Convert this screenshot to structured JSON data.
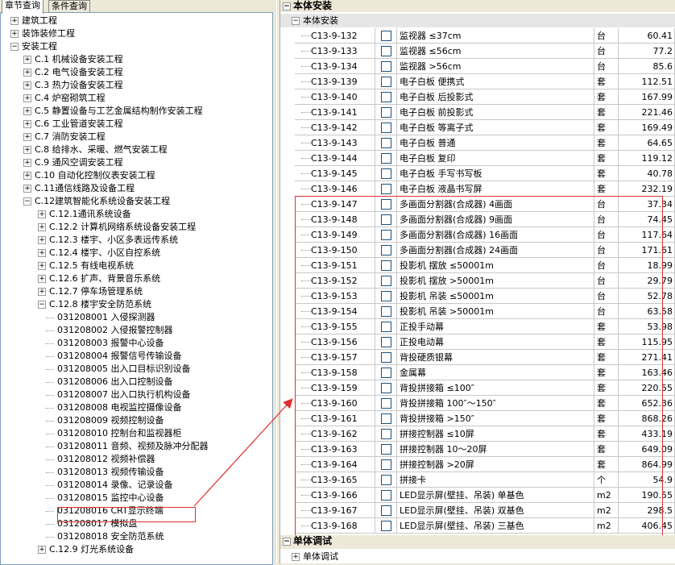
{
  "tabs": [
    "章节查询",
    "条件查询"
  ],
  "tree": [
    {
      "label": "建筑工程",
      "level": 0,
      "exp": "+"
    },
    {
      "label": "装饰装修工程",
      "level": 0,
      "exp": "+"
    },
    {
      "label": "安装工程",
      "level": 0,
      "exp": "-"
    },
    {
      "label": "C.1 机械设备安装工程",
      "level": 1,
      "exp": "+"
    },
    {
      "label": "C.2 电气设备安装工程",
      "level": 1,
      "exp": "+"
    },
    {
      "label": "C.3 热力设备安装工程",
      "level": 1,
      "exp": "+"
    },
    {
      "label": "C.4 炉窑砌筑工程",
      "level": 1,
      "exp": "+"
    },
    {
      "label": "C.5 静置设备与工艺金属结构制作安装工程",
      "level": 1,
      "exp": "+"
    },
    {
      "label": "C.6 工业管道安装工程",
      "level": 1,
      "exp": "+"
    },
    {
      "label": "C.7 消防安装工程",
      "level": 1,
      "exp": "+"
    },
    {
      "label": "C.8 给排水、采暖、燃气安装工程",
      "level": 1,
      "exp": "+"
    },
    {
      "label": "C.9 通风空调安装工程",
      "level": 1,
      "exp": "+"
    },
    {
      "label": "C.10 自动化控制仪表安装工程",
      "level": 1,
      "exp": "+"
    },
    {
      "label": "C.11通信线路及设备工程",
      "level": 1,
      "exp": "+"
    },
    {
      "label": "C.12建筑智能化系统设备安装工程",
      "level": 1,
      "exp": "-"
    },
    {
      "label": "C.12.1通讯系统设备",
      "level": 2,
      "exp": "+"
    },
    {
      "label": "C.12.2 计算机网络系统设备安装工程",
      "level": 2,
      "exp": "+"
    },
    {
      "label": "C.12.3 楼宇、小区多表远传系统",
      "level": 2,
      "exp": "+"
    },
    {
      "label": "C.12.4 楼宇、小区自控系统",
      "level": 2,
      "exp": "+"
    },
    {
      "label": "C.12.5 有线电视系统",
      "level": 2,
      "exp": "+"
    },
    {
      "label": "C.12.6 扩声、背景音乐系统",
      "level": 2,
      "exp": "+"
    },
    {
      "label": "C.12.7 停车场管理系统",
      "level": 2,
      "exp": "+"
    },
    {
      "label": "C.12.8 楼宇安全防范系统",
      "level": 2,
      "exp": "-"
    },
    {
      "label": "031208001   入侵探测器",
      "level": 3,
      "exp": ""
    },
    {
      "label": "031208002   入侵报警控制器",
      "level": 3,
      "exp": ""
    },
    {
      "label": "031208003   报警中心设备",
      "level": 3,
      "exp": ""
    },
    {
      "label": "031208004   报警信号传输设备",
      "level": 3,
      "exp": ""
    },
    {
      "label": "031208005   出入口目标识别设备",
      "level": 3,
      "exp": ""
    },
    {
      "label": "031208006   出入口控制设备",
      "level": 3,
      "exp": ""
    },
    {
      "label": "031208007   出入口执行机构设备",
      "level": 3,
      "exp": ""
    },
    {
      "label": "031208008   电视监控摄像设备",
      "level": 3,
      "exp": ""
    },
    {
      "label": "031208009   视频控制设备",
      "level": 3,
      "exp": ""
    },
    {
      "label": "031208010   控制台和监视器柜",
      "level": 3,
      "exp": ""
    },
    {
      "label": "031208011   音频、视频及脉冲分配器",
      "level": 3,
      "exp": ""
    },
    {
      "label": "031208012   视频补偿器",
      "level": 3,
      "exp": ""
    },
    {
      "label": "031208013   视频传输设备",
      "level": 3,
      "exp": ""
    },
    {
      "label": "031208014   录像、记录设备",
      "level": 3,
      "exp": ""
    },
    {
      "label": "031208015   监控中心设备",
      "level": 3,
      "exp": ""
    },
    {
      "label": "031208016   CRT显示终端",
      "level": 3,
      "exp": ""
    },
    {
      "label": "031208017   模拟盘",
      "level": 3,
      "exp": ""
    },
    {
      "label": "031208018   安全防范系统",
      "level": 3,
      "exp": ""
    },
    {
      "label": "C.12.9 灯光系统设备",
      "level": 2,
      "exp": "+"
    }
  ],
  "right_header": "本体安装",
  "right_subheader": "本体安装",
  "rows": [
    {
      "code": "C13-9-132",
      "name": "监视器 ≤37cm",
      "unit": "台",
      "qty": "60.41"
    },
    {
      "code": "C13-9-133",
      "name": "监视器 ≤56cm",
      "unit": "台",
      "qty": "77.2"
    },
    {
      "code": "C13-9-134",
      "name": "监视器 >56cm",
      "unit": "台",
      "qty": "85.6"
    },
    {
      "code": "C13-9-139",
      "name": "电子白板 便携式",
      "unit": "套",
      "qty": "112.51"
    },
    {
      "code": "C13-9-140",
      "name": "电子白板 后投影式",
      "unit": "套",
      "qty": "167.99"
    },
    {
      "code": "C13-9-141",
      "name": "电子白板 前投影式",
      "unit": "套",
      "qty": "221.46"
    },
    {
      "code": "C13-9-142",
      "name": "电子白板 等离子式",
      "unit": "套",
      "qty": "169.49"
    },
    {
      "code": "C13-9-143",
      "name": "电子白板 普通",
      "unit": "套",
      "qty": "64.65"
    },
    {
      "code": "C13-9-144",
      "name": "电子白板 复印",
      "unit": "套",
      "qty": "119.12"
    },
    {
      "code": "C13-9-145",
      "name": "电子白板 手写书写板",
      "unit": "套",
      "qty": "40.78"
    },
    {
      "code": "C13-9-146",
      "name": "电子白板 液晶书写屏",
      "unit": "套",
      "qty": "232.19"
    },
    {
      "code": "C13-9-147",
      "name": "多画面分割器(合成器) 4画面",
      "unit": "台",
      "qty": "37.34"
    },
    {
      "code": "C13-9-148",
      "name": "多画面分割器(合成器) 9画面",
      "unit": "台",
      "qty": "74.45"
    },
    {
      "code": "C13-9-149",
      "name": "多画面分割器(合成器) 16画面",
      "unit": "台",
      "qty": "117.64"
    },
    {
      "code": "C13-9-150",
      "name": "多画面分割器(合成器) 24画面",
      "unit": "台",
      "qty": "171.61"
    },
    {
      "code": "C13-9-151",
      "name": "投影机 摆放 ≤50001m",
      "unit": "台",
      "qty": "18.99"
    },
    {
      "code": "C13-9-152",
      "name": "投影机 摆放 >50001m",
      "unit": "台",
      "qty": "29.79"
    },
    {
      "code": "C13-9-153",
      "name": "投影机 吊装 ≤50001m",
      "unit": "台",
      "qty": "52.78"
    },
    {
      "code": "C13-9-154",
      "name": "投影机 吊装 >50001m",
      "unit": "台",
      "qty": "63.58"
    },
    {
      "code": "C13-9-155",
      "name": "正投手动幕",
      "unit": "套",
      "qty": "53.98"
    },
    {
      "code": "C13-9-156",
      "name": "正投电动幕",
      "unit": "套",
      "qty": "115.95"
    },
    {
      "code": "C13-9-157",
      "name": "背投硬质银幕",
      "unit": "套",
      "qty": "271.41"
    },
    {
      "code": "C13-9-158",
      "name": "金属幕",
      "unit": "套",
      "qty": "163.46"
    },
    {
      "code": "C13-9-159",
      "name": "背投拼接箱 ≤100″",
      "unit": "套",
      "qty": "220.55"
    },
    {
      "code": "C13-9-160",
      "name": "背投拼接箱 100″～150″",
      "unit": "套",
      "qty": "652.36"
    },
    {
      "code": "C13-9-161",
      "name": "背投拼接箱 >150″",
      "unit": "套",
      "qty": "868.26"
    },
    {
      "code": "C13-9-162",
      "name": "拼接控制器 ≤10屏",
      "unit": "套",
      "qty": "433.19"
    },
    {
      "code": "C13-9-163",
      "name": "拼接控制器 10～20屏",
      "unit": "套",
      "qty": "649.09"
    },
    {
      "code": "C13-9-164",
      "name": "拼接控制器 >20屏",
      "unit": "套",
      "qty": "864.99"
    },
    {
      "code": "C13-9-165",
      "name": "拼接卡",
      "unit": "个",
      "qty": "54.9"
    },
    {
      "code": "C13-9-166",
      "name": "LED显示屏(壁挂、吊装) 单基色",
      "unit": "m2",
      "qty": "190.55"
    },
    {
      "code": "C13-9-167",
      "name": "LED显示屏(壁挂、吊装) 双基色",
      "unit": "m2",
      "qty": "298.5"
    },
    {
      "code": "C13-9-168",
      "name": "LED显示屏(壁挂、吊装) 三基色",
      "unit": "m2",
      "qty": "406.45"
    }
  ],
  "bottom_header": "单体调试",
  "bottom_row": "单体调试",
  "colors": {
    "highlight": "#e03030",
    "arrow": "#e03030"
  }
}
